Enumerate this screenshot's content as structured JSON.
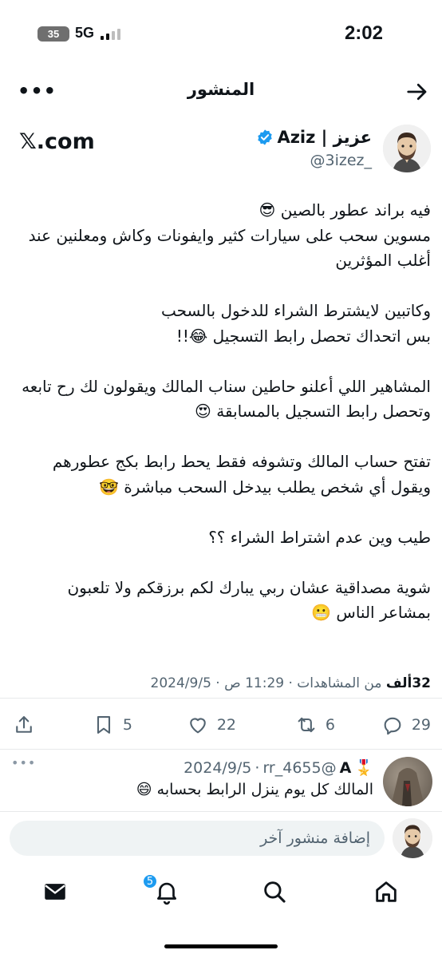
{
  "status_bar": {
    "time": "2:02",
    "battery": "35",
    "network": "5G"
  },
  "header": {
    "title": "المنشور",
    "back_icon": "arrow-right-icon",
    "more_icon": "more-horizontal-icon",
    "more_label": "•••"
  },
  "author": {
    "name": "عزيز | Aziz",
    "handle": "@3izez_",
    "verified_icon": "verified-badge-icon",
    "site": "𝕏.com"
  },
  "post": {
    "text": "فيه براند عطور بالصين 😎\nمسوين سحب على سيارات كثير وايفونات وكاش ومعلنين عند أغلب المؤثرين\n\nوكاتبين لايشترط الشراء للدخول بالسحب\nبس اتحداك تحصل رابط التسجيل 😂!!\n\nالمشاهير اللي أعلنو حاطين سناب المالك ويقولون لك رح تابعه وتحصل رابط التسجيل بالمسابقة 😍\n\nتفتح حساب المالك وتشوفه فقط يحط رابط بكج عطورهم ويقول أي شخص يطلب بيدخل السحب مباشرة 🤓\n\nطيب وين عدم اشتراط الشراء ؟؟\n\nشوية مصداقية عشان ربي يبارك لكم برزقكم ولا تلعبون بمشاعر الناس 😬"
  },
  "meta": {
    "time": "11:29 ص",
    "date": "2024/9/5",
    "separator": "·",
    "views_count": "32ألف",
    "views_label": "من المشاهدات"
  },
  "actions": {
    "replies": "29",
    "retweets": "6",
    "likes": "22",
    "bookmarks": "5"
  },
  "reply": {
    "name": "A",
    "medal": "🎖️",
    "handle": "@rr_4655",
    "separator": "·",
    "date": "2024/9/5",
    "text": "المالك كل يوم ينزل الرابط بحسابه 😄",
    "more_label": "•••"
  },
  "compose": {
    "placeholder": "إضافة منشور آخر"
  },
  "tabbar": {
    "notifications_badge": "5",
    "icons": [
      "home-icon",
      "search-icon",
      "notifications-icon",
      "messages-icon"
    ]
  },
  "colors": {
    "accent": "#1d9bf0",
    "muted": "#536471",
    "text": "#0f1419"
  }
}
